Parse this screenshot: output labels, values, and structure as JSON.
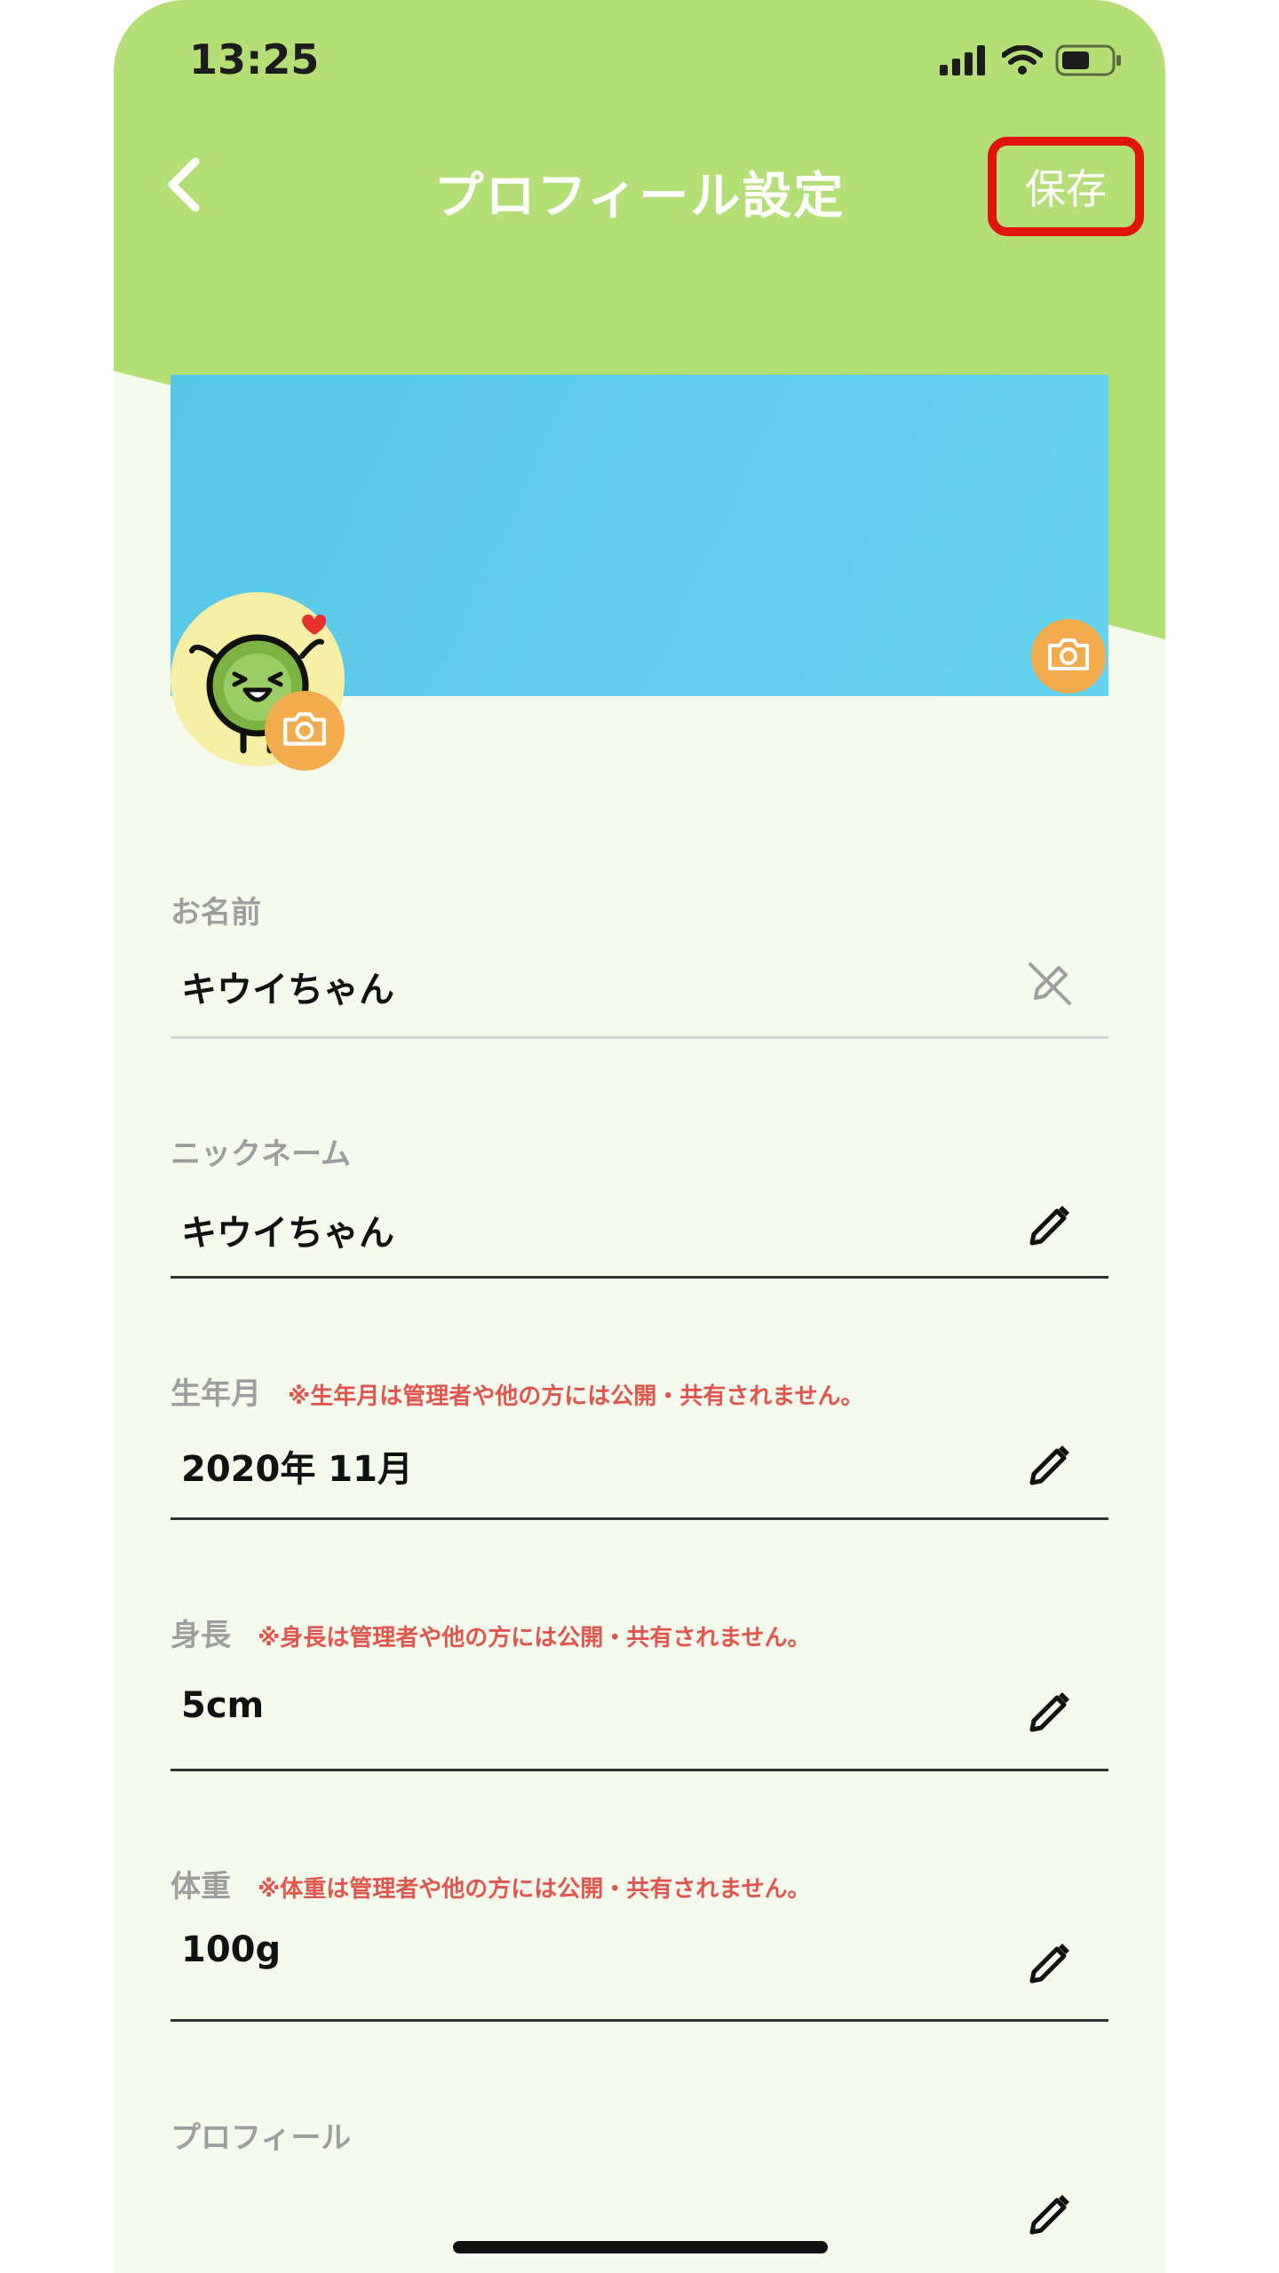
{
  "status_bar": {
    "time": "13:25",
    "signal_icon": "cellular-signal-icon",
    "wifi_icon": "wifi-icon",
    "battery_icon": "battery-icon"
  },
  "header": {
    "back_icon": "chevron-left-icon",
    "title": "プロフィール設定",
    "save_label": "保存"
  },
  "colors": {
    "header_green": "#b4df77",
    "background": "#f5fbec",
    "cover": "#5ec9e8",
    "camera_badge": "#f2ac4e",
    "highlight_red": "#e1150f",
    "note_red": "#e0564f"
  },
  "profile": {
    "cover_camera_icon": "camera-icon",
    "avatar_camera_icon": "camera-icon"
  },
  "fields": [
    {
      "label": "お名前",
      "note": "",
      "value": "キウイちゃん",
      "icon": "edit-disabled-icon",
      "editable": false
    },
    {
      "label": "ニックネーム",
      "note": "",
      "value": "キウイちゃん",
      "icon": "pencil-icon",
      "editable": true
    },
    {
      "label": "生年月",
      "note": "※生年月は管理者や他の方には公開・共有されません。",
      "value": "2020年 11月",
      "icon": "pencil-icon",
      "editable": true
    },
    {
      "label": "身長",
      "note": "※身長は管理者や他の方には公開・共有されません。",
      "value": "5cm",
      "icon": "pencil-icon",
      "editable": true
    },
    {
      "label": "体重",
      "note": "※体重は管理者や他の方には公開・共有されません。",
      "value": "100g",
      "icon": "pencil-icon",
      "editable": true
    },
    {
      "label": "プロフィール",
      "note": "",
      "value": "",
      "icon": "pencil-icon",
      "editable": true
    }
  ]
}
